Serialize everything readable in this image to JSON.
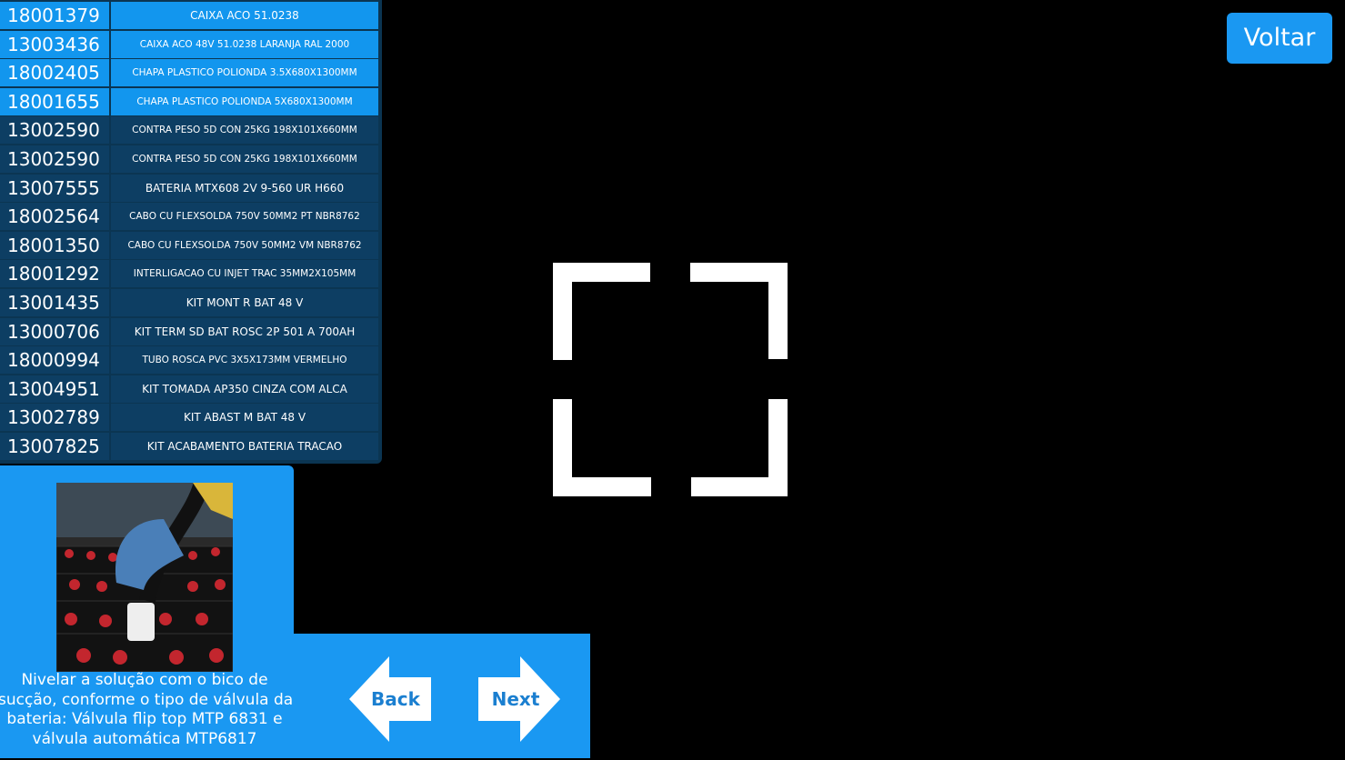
{
  "parts": [
    {
      "code": "18001379",
      "desc": "CAIXA ACO 51.0238",
      "selected": true
    },
    {
      "code": "13003436",
      "desc": "CAIXA ACO 48V 51.0238 LARANJA RAL 2000",
      "selected": true
    },
    {
      "code": "18002405",
      "desc": "CHAPA PLASTICO POLIONDA 3.5X680X1300MM",
      "selected": true
    },
    {
      "code": "18001655",
      "desc": "CHAPA PLASTICO POLIONDA 5X680X1300MM",
      "selected": true
    },
    {
      "code": "13002590",
      "desc": "CONTRA PESO 5D CON 25KG 198X101X660MM",
      "selected": false
    },
    {
      "code": "13002590",
      "desc": "CONTRA PESO 5D CON 25KG 198X101X660MM",
      "selected": false
    },
    {
      "code": "13007555",
      "desc": "BATERIA MTX608 2V 9-560 UR H660",
      "selected": false
    },
    {
      "code": "18002564",
      "desc": "CABO CU FLEXSOLDA 750V 50MM2 PT NBR8762",
      "selected": false
    },
    {
      "code": "18001350",
      "desc": "CABO CU FLEXSOLDA 750V 50MM2 VM NBR8762",
      "selected": false
    },
    {
      "code": "18001292",
      "desc": "INTERLIGACAO CU INJET TRAC 35MM2X105MM",
      "selected": false
    },
    {
      "code": "13001435",
      "desc": "KIT MONT R BAT 48 V",
      "selected": false
    },
    {
      "code": "13000706",
      "desc": "KIT TERM SD BAT ROSC 2P 501 A 700AH",
      "selected": false
    },
    {
      "code": "18000994",
      "desc": "TUBO ROSCA PVC 3X5X173MM VERMELHO",
      "selected": false
    },
    {
      "code": "13004951",
      "desc": "KIT TOMADA AP350 CINZA COM ALCA",
      "selected": false
    },
    {
      "code": "13002789",
      "desc": "KIT ABAST M BAT 48 V",
      "selected": false
    },
    {
      "code": "13007825",
      "desc": "KIT ACABAMENTO BATERIA TRACAO",
      "selected": false
    }
  ],
  "header": {
    "back_label": "Voltar"
  },
  "instruction": {
    "lines": [
      "Nivelar a solução com o bico de",
      "sucção, conforme o tipo de válvula da",
      "bateria: Válvula flip top MTP 6831 e",
      "válvula automática MTP6817"
    ]
  },
  "nav": {
    "back": "Back",
    "next": "Next"
  },
  "colors": {
    "accent": "#1a98f2",
    "list_bg": "#0d3e63",
    "selected": "#1296ee",
    "nav_text": "#1b7fd0"
  },
  "icons": {
    "focus": "scan-frame-icon",
    "back": "arrow-left-icon",
    "next": "arrow-right-icon"
  }
}
